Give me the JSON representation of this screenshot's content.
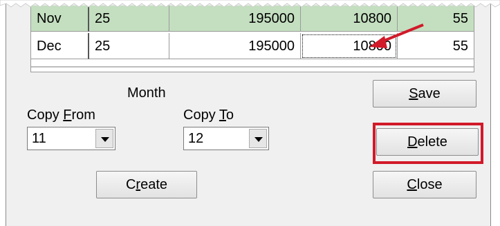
{
  "grid": {
    "rows": [
      {
        "month": "Nov",
        "c1": "25",
        "c2": "195000",
        "c3": "10800",
        "c4": "55"
      },
      {
        "month": "Dec",
        "c1": "25",
        "c2": "195000",
        "c3": "10800",
        "c4": "55"
      }
    ]
  },
  "month_label": "Month",
  "copy_from": {
    "label_pre": "Copy ",
    "label_mnemonic": "F",
    "label_post": "rom",
    "value": "11"
  },
  "copy_to": {
    "label_pre": "Copy ",
    "label_mnemonic": "T",
    "label_post": "o",
    "value": "12"
  },
  "buttons": {
    "save": {
      "mnemonic": "S",
      "rest": "ave"
    },
    "delete": {
      "mnemonic": "D",
      "rest": "elete"
    },
    "close": {
      "mnemonic": "C",
      "rest": "lose"
    },
    "create": {
      "pre": "C",
      "mnemonic": "r",
      "rest": "eate"
    }
  },
  "colors": {
    "selected_row": "#c4dfc0",
    "callout": "#d11a2a"
  }
}
